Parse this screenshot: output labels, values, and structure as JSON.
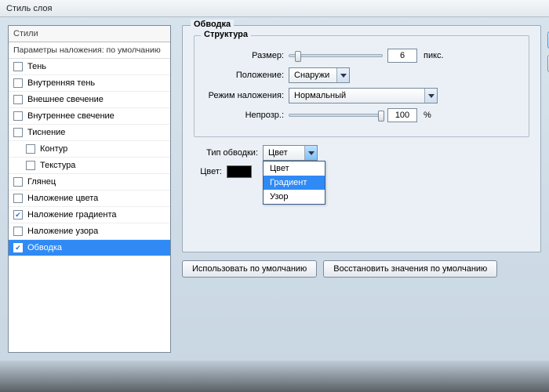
{
  "window": {
    "title": "Стиль слоя"
  },
  "sidebar": {
    "header": "Стили",
    "subheader": "Параметры наложения: по умолчанию",
    "items": [
      {
        "label": "Тень",
        "checked": false
      },
      {
        "label": "Внутренняя тень",
        "checked": false
      },
      {
        "label": "Внешнее свечение",
        "checked": false
      },
      {
        "label": "Внутреннее свечение",
        "checked": false
      },
      {
        "label": "Тиснение",
        "checked": false
      },
      {
        "label": "Контур",
        "checked": false,
        "indent": true
      },
      {
        "label": "Текстура",
        "checked": false,
        "indent": true
      },
      {
        "label": "Глянец",
        "checked": false
      },
      {
        "label": "Наложение цвета",
        "checked": false
      },
      {
        "label": "Наложение градиента",
        "checked": true
      },
      {
        "label": "Наложение узора",
        "checked": false
      },
      {
        "label": "Обводка",
        "checked": true,
        "selected": true
      }
    ]
  },
  "panel": {
    "title": "Обводка",
    "structure": {
      "legend": "Структура",
      "size": {
        "label": "Размер:",
        "value": "6",
        "unit": "пикс.",
        "thumb_pct": 6
      },
      "position": {
        "label": "Положение:",
        "value": "Снаружи"
      },
      "blend": {
        "label": "Режим наложения:",
        "value": "Нормальный"
      },
      "opacity": {
        "label": "Непрозр.:",
        "value": "100",
        "unit": "%",
        "thumb_pct": 96
      }
    },
    "stroke_type": {
      "label": "Тип обводки:",
      "value": "Цвет",
      "options": [
        "Цвет",
        "Градиент",
        "Узор"
      ],
      "highlight_index": 1
    },
    "color": {
      "label": "Цвет:",
      "swatch": "#000000"
    },
    "buttons": {
      "use_default": "Использовать по умолчанию",
      "reset_default": "Восстановить значения по умолчанию"
    }
  }
}
